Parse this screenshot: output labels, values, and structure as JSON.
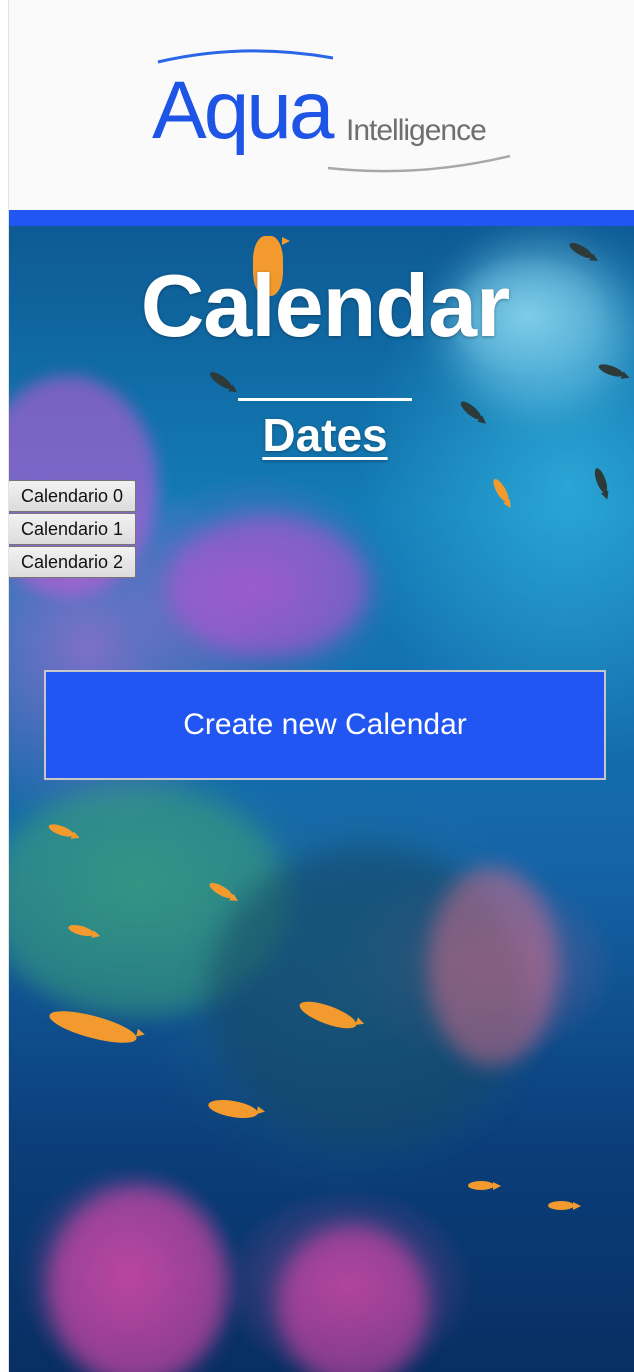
{
  "header": {
    "logo_main": "Aqua",
    "logo_sub": "Intelligence",
    "brand_color": "#2156f3"
  },
  "hero": {
    "title": "Calendar",
    "subtitle": "Dates"
  },
  "calendars": [
    {
      "label": "Calendario 0"
    },
    {
      "label": "Calendario 1"
    },
    {
      "label": "Calendario 2"
    }
  ],
  "actions": {
    "create_label": "Create new Calendar",
    "create_color": "#2156f3"
  }
}
